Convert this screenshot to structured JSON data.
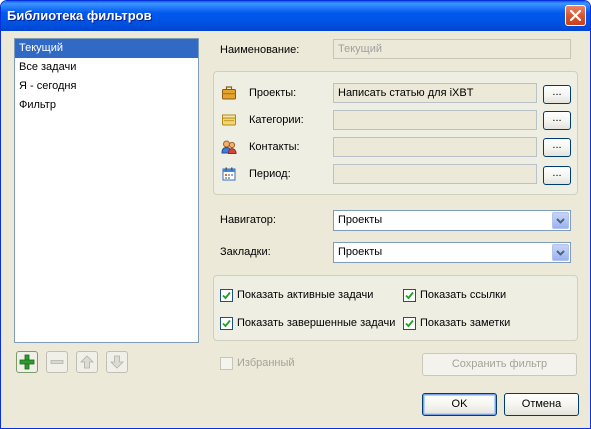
{
  "window": {
    "title": "Библиотека фильтров"
  },
  "filter_list": {
    "items": [
      "Текущий",
      "Все задачи",
      "Я - сегодня",
      "Фильтр"
    ],
    "selected": "Текущий"
  },
  "form": {
    "name_label": "Наименование:",
    "name_value": "Текущий",
    "projects_label": "Проекты:",
    "projects_value": "Написать статью для iXBT",
    "categories_label": "Категории:",
    "categories_value": "",
    "contacts_label": "Контакты:",
    "contacts_value": "",
    "period_label": "Период:",
    "period_value": "",
    "ellipsis_label": "...",
    "navigator_label": "Навигатор:",
    "navigator_value": "Проекты",
    "bookmarks_label": "Закладки:",
    "bookmarks_value": "Проекты"
  },
  "options": {
    "show_active_tasks": {
      "label": "Показать активные задачи",
      "checked": true
    },
    "show_links": {
      "label": "Показать ссылки",
      "checked": true
    },
    "show_completed_tasks": {
      "label": "Показать завершенные задачи",
      "checked": true
    },
    "show_notes": {
      "label": "Показать заметки",
      "checked": true
    }
  },
  "favorite": {
    "label": "Избранный",
    "checked": false,
    "enabled": false
  },
  "buttons": {
    "save_filter": "Сохранить фильтр",
    "ok": "OK",
    "cancel": "Отмена"
  },
  "icons": {
    "add": "plus-icon",
    "remove": "minus-icon",
    "move_up": "arrow-up-icon",
    "move_down": "arrow-down-icon",
    "projects": "briefcase-icon",
    "categories": "folder-card-icon",
    "contacts": "people-icon",
    "period": "calendar-icon"
  },
  "colors": {
    "titlebar": "#0054e3",
    "selection": "#316ac5",
    "add_button": "#2e9a2e"
  }
}
